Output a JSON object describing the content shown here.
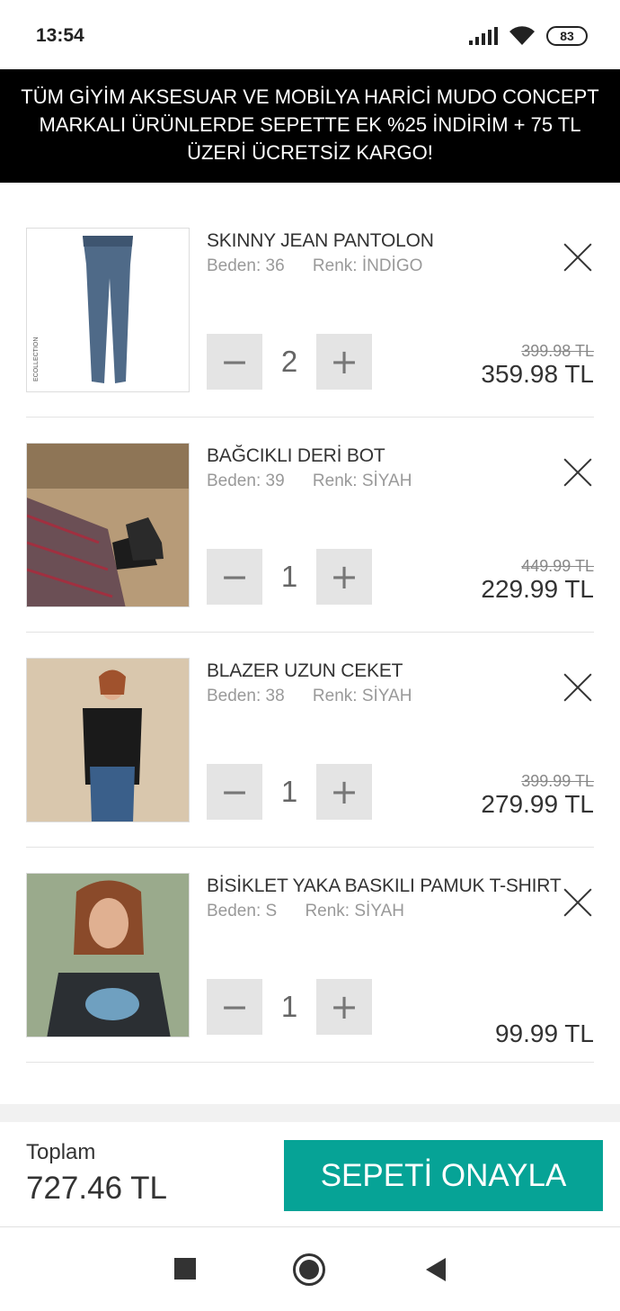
{
  "status": {
    "time": "13:54",
    "battery": "83"
  },
  "promo": {
    "text": "TÜM GİYİM AKSESUAR VE MOBİLYA HARİCİ MUDO CONCEPT MARKALI ÜRÜNLERDE SEPETTE EK %25 İNDİRİM + 75 TL ÜZERİ ÜCRETSİZ KARGO!"
  },
  "items": [
    {
      "name": "SKINNY JEAN PANTOLON",
      "size": "Beden: 36",
      "color": "Renk: İNDİGO",
      "quantity": "2",
      "old_price": "399.98 TL",
      "price": "359.98 TL",
      "thumb_label": "ECOLLECTION"
    },
    {
      "name": "BAĞCIKLI DERİ BOT",
      "size": "Beden: 39",
      "color": "Renk: SİYAH",
      "quantity": "1",
      "old_price": "449.99 TL",
      "price": "229.99 TL"
    },
    {
      "name": "BLAZER UZUN CEKET",
      "size": "Beden: 38",
      "color": "Renk: SİYAH",
      "quantity": "1",
      "old_price": "399.99 TL",
      "price": "279.99 TL"
    },
    {
      "name": "BİSİKLET YAKA BASKILI PAMUK T-SHIRT",
      "size": "Beden: S",
      "color": "Renk: SİYAH",
      "quantity": "1",
      "old_price": "",
      "price": "99.99 TL"
    }
  ],
  "qty_controls": {
    "minus": "−",
    "plus": "+"
  },
  "footer": {
    "total_label": "Toplam",
    "total_value": "727.46 TL",
    "confirm_label": "SEPETİ ONAYLA"
  },
  "colors": {
    "accent": "#06a396",
    "banner_bg": "#000000"
  }
}
